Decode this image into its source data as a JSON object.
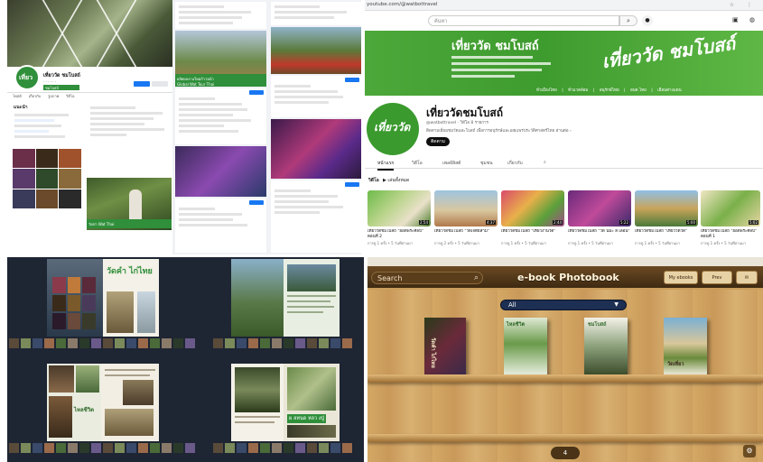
{
  "facebook": {
    "page_name": "เที่ยววัด ชมโบสถ์",
    "brand_tag": "ชมโบสถ์",
    "avatar_text": "เที่ยว",
    "intro_title": "แนะนำ",
    "nav_tabs": [
      "โพสต์",
      "เกี่ยวกับ",
      "รูปภาพ",
      "วิดีโอ"
    ],
    "post_banner": "วัดป่า Wat Thai",
    "cover_post_caption": "ผลิตผลงานใหม่ก้าวหน้า",
    "cover_post_sub": "Global Wat Tour Thai"
  },
  "youtube": {
    "url": "youtube.com/@watbottravel",
    "search_placeholder": "ค้นหา",
    "banner_title": "เที่ยววัด ชมโบสถ์",
    "banner_logo": "เที่ยววัด ชมโบสถ์",
    "banner_links": [
      "ทั่วเมืองไทย",
      "ทั่วแวดล้อม",
      "อนุรักษ์ไทย",
      "อบต.ไทย",
      "เยือนต่างแดน"
    ],
    "avatar_text": "เที่ยววัด",
    "channel_name": "เที่ยววัดชมโบสถ์",
    "channel_meta": "@watbottravel · วิดีโอ 8 รายการ",
    "channel_desc": "ติดตามเยี่ยมชมวัดและโบสถ์ เพื่อการอนุรักษ์และเผยแพร่ประวัติศาสตร์ไทย อ่านต่อ ›",
    "subscribe_label": "ติดตาม",
    "tabs": [
      "หน้าแรก",
      "วิดีโอ",
      "เพลย์ลิสต์",
      "ชุมชน",
      "เกี่ยวกับ"
    ],
    "section_title": "วิดีโอ",
    "play_all": "▶ เล่นทั้งหมด",
    "videos": [
      {
        "title": "เที่ยววัดชมโบสถ์ \"ยอดพระศิลป์\" ตอนที่ 2",
        "duration": "2:54",
        "meta": "การดู 1 ครั้ง • 5 วันที่ผ่านมา"
      },
      {
        "title": "เที่ยววัดชมโบสถ์ \"วัดเจดีย์สาม\"",
        "duration": "4:37",
        "meta": "การดู 2 ครั้ง • 5 วันที่ผ่านมา"
      },
      {
        "title": "เที่ยววัดชมโบสถ์ \"เที่ยวงานวัด\"",
        "duration": "2:44",
        "meta": "การดู 1 ครั้ง • 5 วันที่ผ่านมา"
      },
      {
        "title": "เที่ยววัดชมโบสถ์ \"วัด นมะ ลี เลือน\"",
        "duration": "5:22",
        "meta": "การดู 1 ครั้ง • 5 วันที่ผ่านมา"
      },
      {
        "title": "เที่ยววัดชมโบสถ์ \"เที่ยววัดวัด\"",
        "duration": "5:00",
        "meta": "การดู 1 ครั้ง • 5 วันที่ผ่านมา"
      },
      {
        "title": "เที่ยววัดชมโบสถ์ \"ยอดพระศิลป์\" ตอนที่ 1",
        "duration": "5:02",
        "meta": "การดู 1 ครั้ง • 5 วันที่ผ่านมา"
      }
    ]
  },
  "flipbook": {
    "spread1_title": "วัดคำ ไก่ไทย",
    "spread4_caption": "ผ ลหนด หลว งปู่",
    "spread3_caption": "ไหลชีวิต"
  },
  "bookshelf": {
    "search_label": "Search",
    "title": "e-book Photobook",
    "my_books_label": "My ebooks",
    "prev_label": "Prev",
    "category": "All",
    "page_number": "4",
    "books": [
      "วัดคำ ไก่ไทย",
      "ไหลชีวิต",
      "ชมโบสถ์",
      "วัดเที่ยว"
    ]
  },
  "colors": {
    "brand_green": "#3e9b2e",
    "fb_blue": "#1877f2",
    "yt_black": "#0f0f0f"
  }
}
